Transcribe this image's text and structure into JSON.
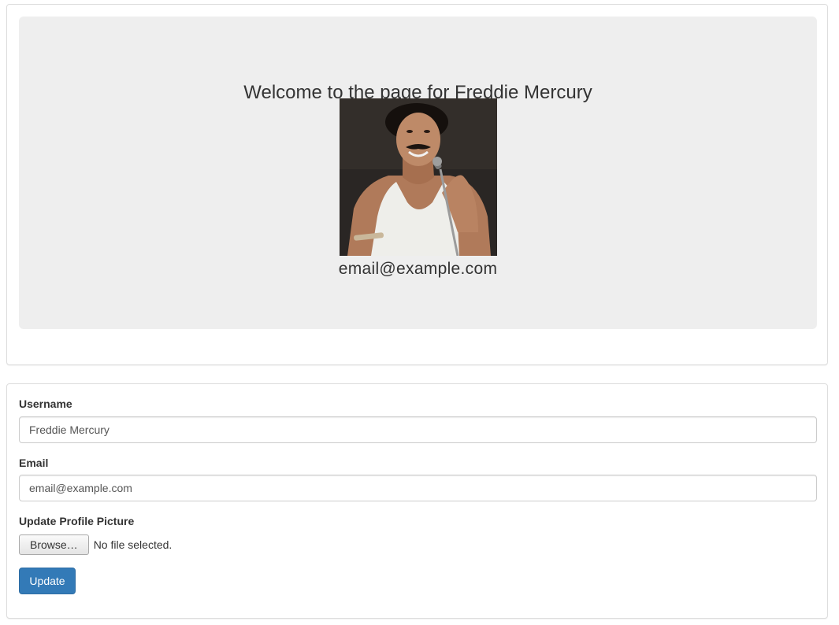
{
  "profile": {
    "welcome_text": "Welcome to the page for Freddie Mercury",
    "email": "email@example.com",
    "photo_alt": "Freddie Mercury"
  },
  "form": {
    "username_label": "Username",
    "username_value": "Freddie Mercury",
    "email_label": "Email",
    "email_value": "email@example.com",
    "picture_label": "Update Profile Picture",
    "browse_label": "Browse…",
    "file_status": "No file selected.",
    "update_label": "Update"
  },
  "colors": {
    "primary": "#337ab7",
    "jumbotron_bg": "#eeeeee",
    "border": "#dddddd"
  }
}
